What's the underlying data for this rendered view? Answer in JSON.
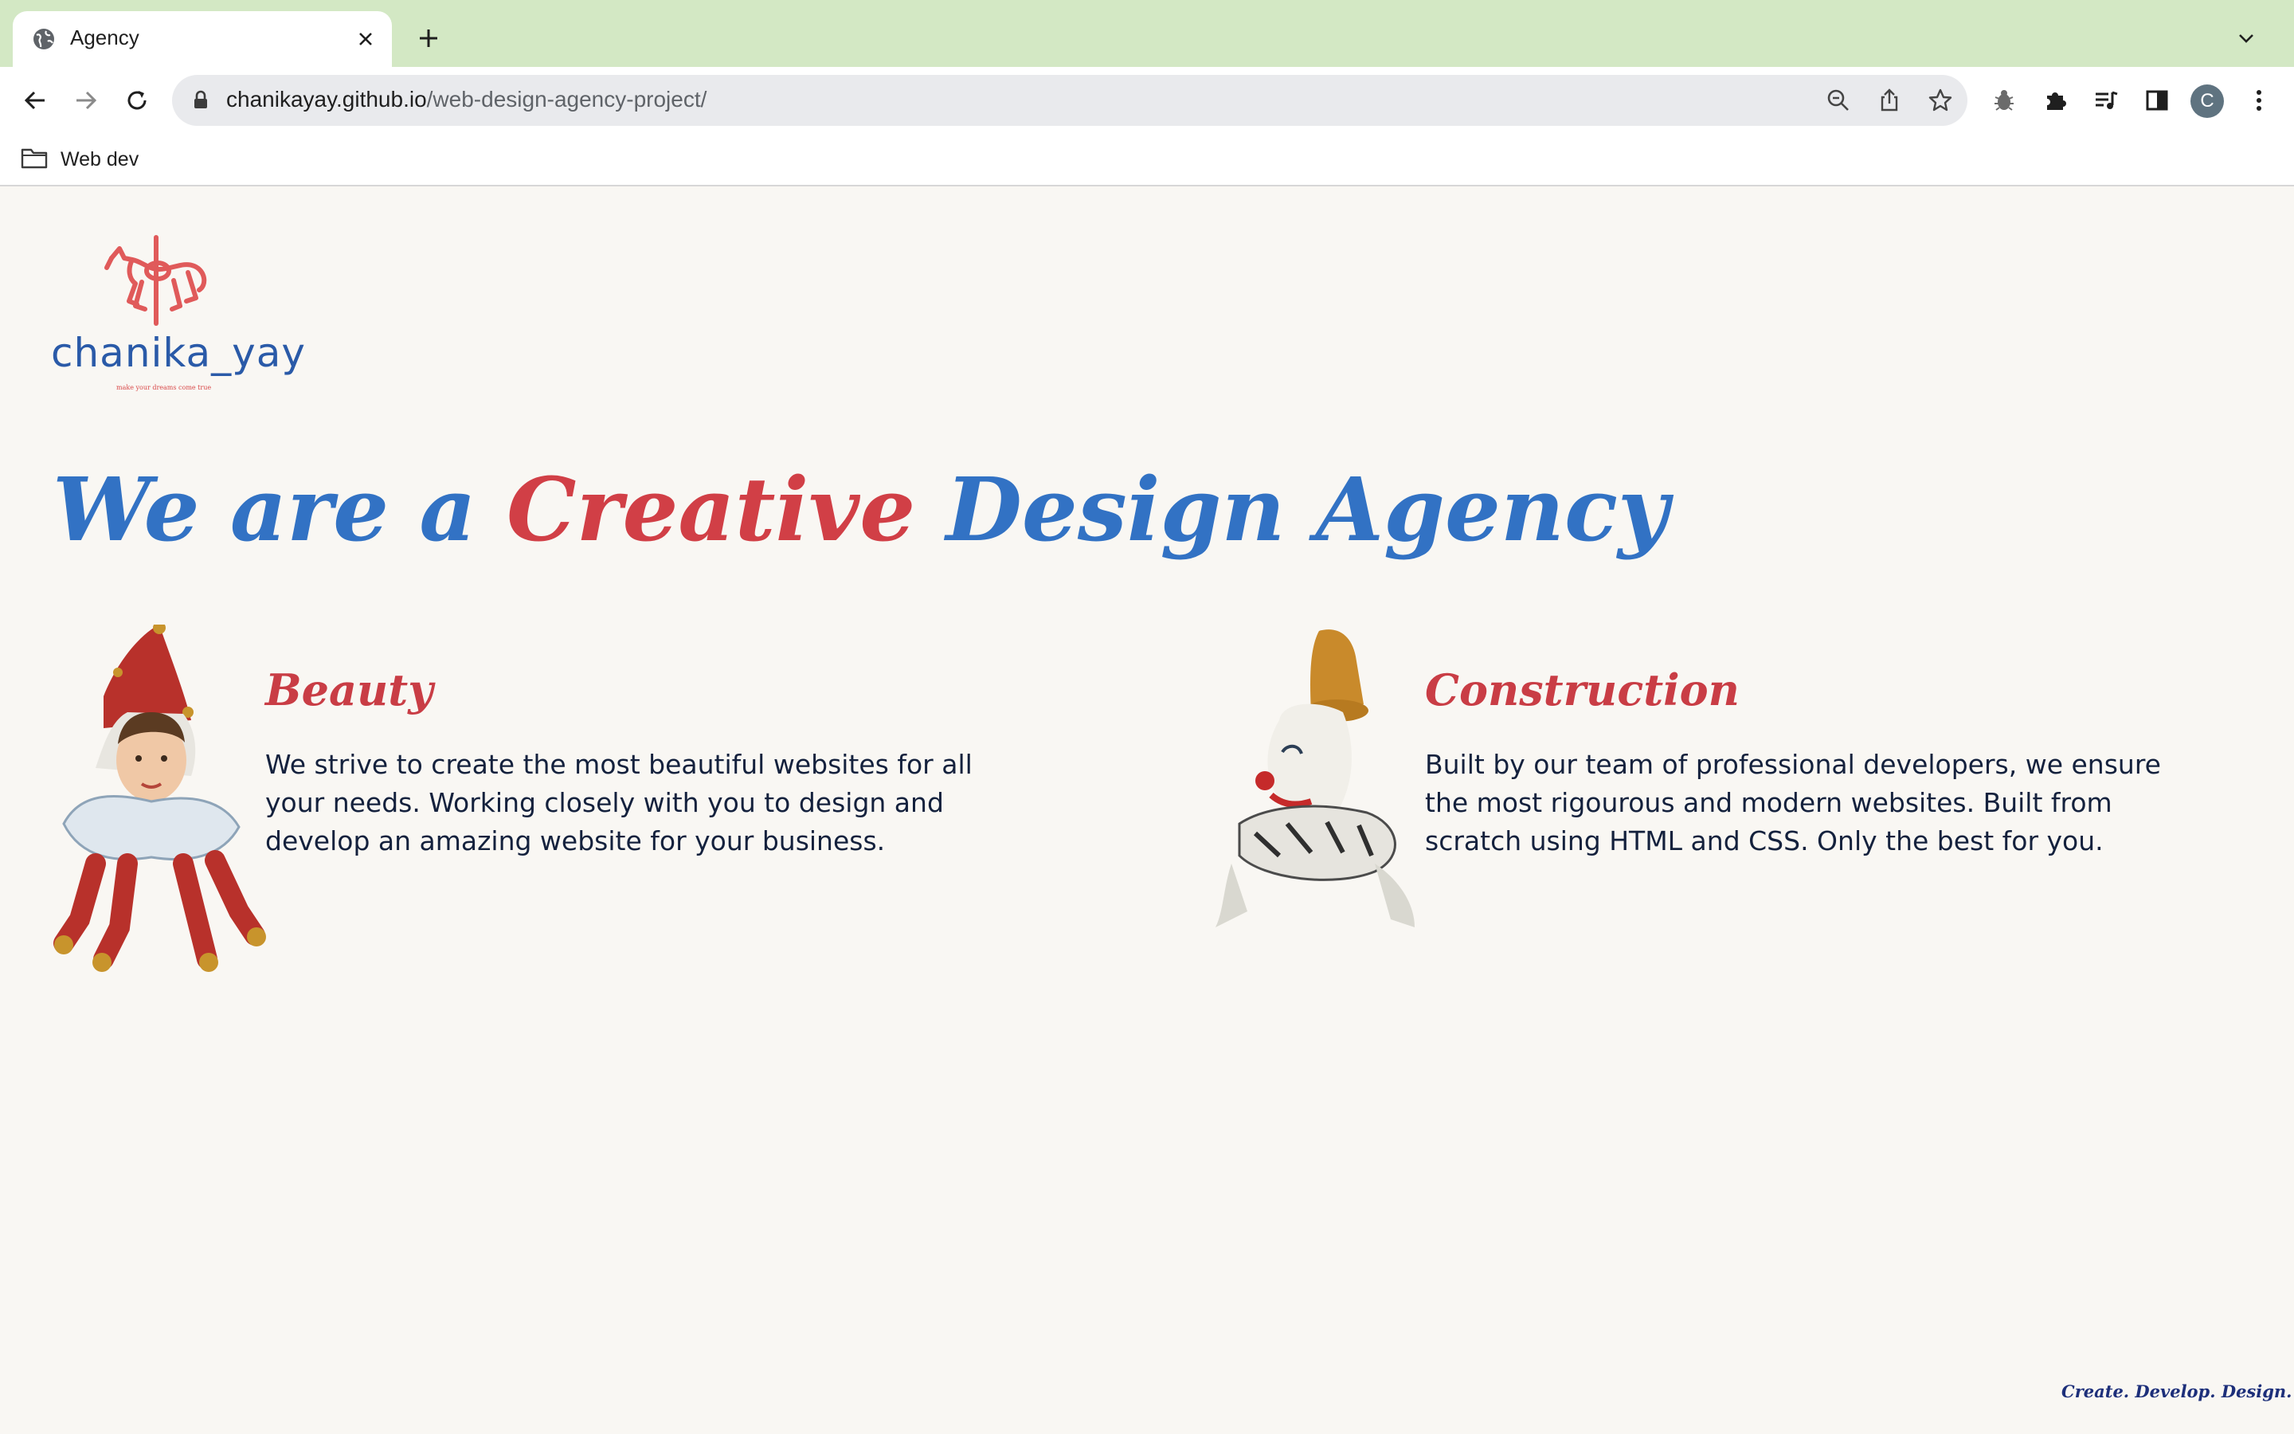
{
  "browser": {
    "tab_title": "Agency",
    "url_host": "chanikayay.github.io",
    "url_path": "/web-design-agency-project/",
    "profile_initial": "C",
    "bookmarks": [
      {
        "label": "Web dev",
        "icon": "folder-icon"
      }
    ],
    "colors": {
      "tabstrip": "#d3e8c4",
      "omnibox": "#e9eaed"
    }
  },
  "page": {
    "logo_wordmark": "chanika_yay",
    "logo_tagline": "make your dreams come true",
    "headline_part1": "We are a ",
    "headline_accent": "Creative",
    "headline_part2": " Design Agency",
    "features": [
      {
        "title": "Beauty",
        "body": "We strive to create the most beautiful websites for all your needs. Working closely with you to design and develop an amazing website for your business.",
        "image": "jester-illustration"
      },
      {
        "title": "Construction",
        "body": "Built by our team of professional developers, we ensure the most rigourous and modern websites. Built from scratch using HTML and CSS. Only the best for you.",
        "image": "clown-illustration"
      }
    ],
    "footer": "Create. Develop. Design.",
    "colors": {
      "background": "#f9f7f3",
      "blue": "#3272c4",
      "red": "#d13f46",
      "body_text": "#14213d",
      "footer_text": "#1d2f7a"
    }
  }
}
